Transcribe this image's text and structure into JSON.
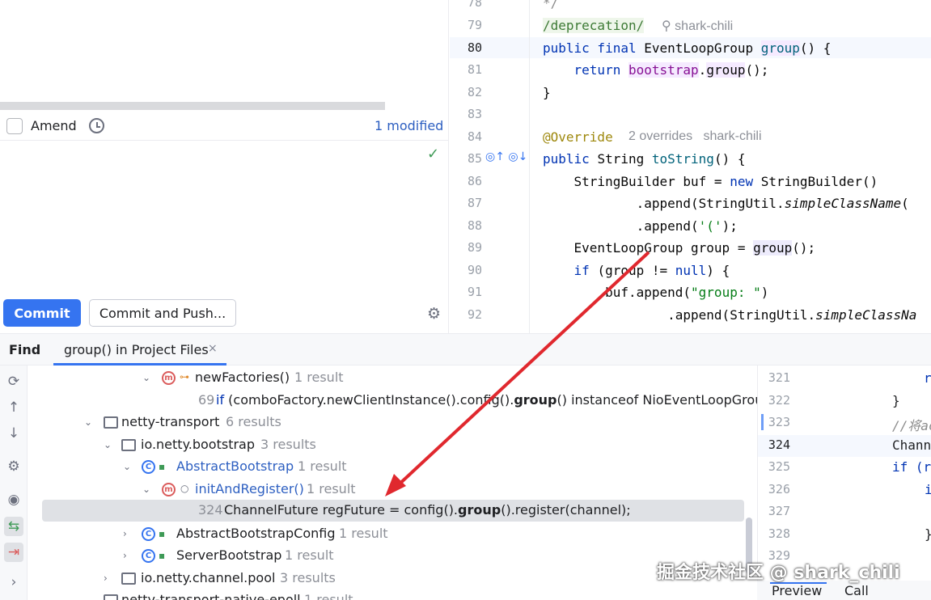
{
  "commit_panel": {
    "amend_label": "Amend",
    "modified_label": "1 modified",
    "check_glyph": "✓",
    "commit_button": "Commit",
    "commit_push_button": "Commit and Push...",
    "gear_glyph": "⚙"
  },
  "editor": {
    "lines": [
      {
        "num": "78",
        "code": "*/"
      },
      {
        "num": "79",
        "code": "/deprecation/",
        "hint": "shark-chili"
      },
      {
        "num": "80",
        "code": "public final EventLoopGroup group() {"
      },
      {
        "num": "81",
        "code": "    return bootstrap.group();"
      },
      {
        "num": "82",
        "code": "}"
      },
      {
        "num": "83",
        "code": ""
      },
      {
        "num": "84",
        "code": "@Override",
        "hint": "2 overrides   shark-chili"
      },
      {
        "num": "85",
        "code": "public String toString() {"
      },
      {
        "num": "86",
        "code": "    StringBuilder buf = new StringBuilder()"
      },
      {
        "num": "87",
        "code": "            .append(StringUtil.simpleClassName("
      },
      {
        "num": "88",
        "code": "            .append('(');"
      },
      {
        "num": "89",
        "code": "    EventLoopGroup group = group();"
      },
      {
        "num": "90",
        "code": "    if (group != null) {"
      },
      {
        "num": "91",
        "code": "        buf.append(\"group: \")"
      },
      {
        "num": "92",
        "code": "                .append(StringUtil.simpleClassNa"
      }
    ]
  },
  "find": {
    "title": "Find",
    "tab_label": "group() in Project Files",
    "tab_close": "×"
  },
  "tree": {
    "rows": [
      {
        "label": "newFactories()",
        "count": "1 result"
      },
      {
        "line": "69",
        "pre": "if",
        "text": " (comboFactory.newClientInstance().config().",
        "bold": "group",
        "post": "() instanceof NioEventLoopGroup) {"
      },
      {
        "label": "netty-transport",
        "count": "6 results"
      },
      {
        "label": "io.netty.bootstrap",
        "count": "3 results"
      },
      {
        "label": "AbstractBootstrap",
        "count": "1 result"
      },
      {
        "label": "initAndRegister()",
        "count": "1 result"
      },
      {
        "line": "324",
        "text": "ChannelFuture regFuture = config().",
        "bold": "group",
        "post": "().register(channel);"
      },
      {
        "label": "AbstractBootstrapConfig",
        "count": "1 result"
      },
      {
        "label": "ServerBootstrap",
        "count": "1 result"
      },
      {
        "label": "io.netty.channel.pool",
        "count": "3 results"
      },
      {
        "label": "netty-transport-native-epoll",
        "count": "1 result"
      }
    ]
  },
  "preview": {
    "lines": [
      {
        "num": "321",
        "code": "r"
      },
      {
        "num": "322",
        "code": "}"
      },
      {
        "num": "323",
        "code": "//将ac"
      },
      {
        "num": "324",
        "code": "Chann"
      },
      {
        "num": "325",
        "code": "if (r"
      },
      {
        "num": "326",
        "code": "i"
      },
      {
        "num": "327",
        "code": ""
      },
      {
        "num": "328",
        "code": "}"
      },
      {
        "num": "329",
        "code": ""
      }
    ],
    "tab_preview": "Preview",
    "tab_hierarchy": "Call Hierarchy"
  },
  "watermark": "掘金技术社区 @ shark_chili",
  "colors": {
    "accent": "#3574f0",
    "arrow": "#e0282e"
  }
}
